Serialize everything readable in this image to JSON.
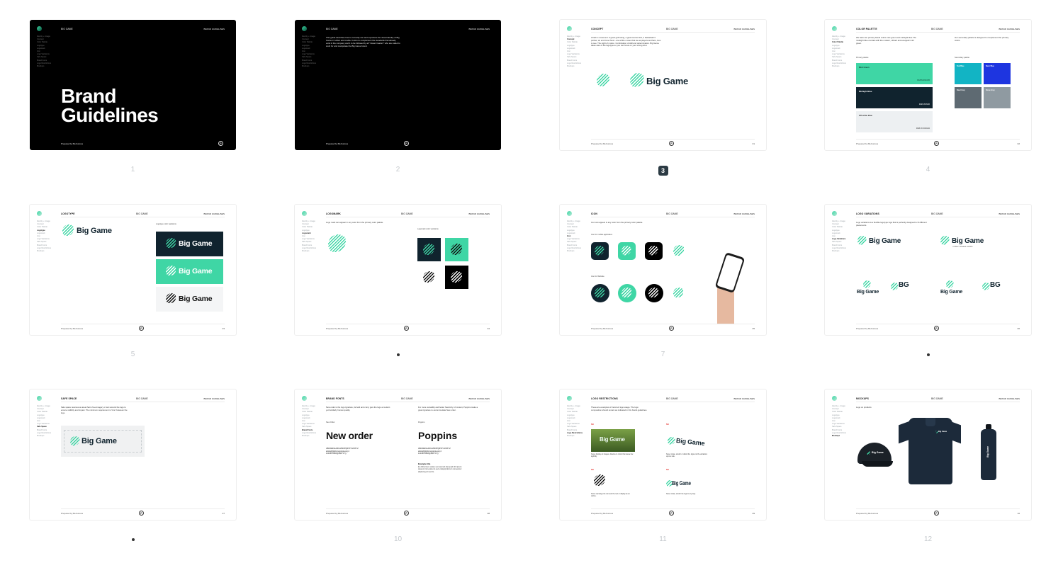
{
  "brand": {
    "name": "Big Game",
    "short": "BG",
    "header_brand": "BIG GAME",
    "header_guides": "BRAND GUIDELINES",
    "prepared_by": "Prepared by BeCurious",
    "footer_mark": "P"
  },
  "colors": {
    "green": "#3fd6a5",
    "navy": "#10232e",
    "black": "#000000"
  },
  "nav": [
    "Identity + Usage",
    "Concept",
    "Color Palette",
    "Logotype",
    "Logomark",
    "Icon",
    "Logo Variations",
    "Safe Space",
    "Brand Fonts",
    "Logo Restrictions",
    "Mockups"
  ],
  "slides": [
    {
      "num": "1",
      "title": "Brand Guidelines",
      "title_l1": "Brand",
      "title_l2": "Guidelines"
    },
    {
      "num": "2",
      "intro": "This guide describes how to correctly use and reproduce the visual identity of Big Game in written and media. It aims to complement the standards that already exist in the company and it to be followed by all \"visual creators\" who are called to work for and manipulate the Big Game brand."
    },
    {
      "num": "3",
      "page": "01",
      "title": "CONCEPT",
      "text": "A ball in movement. A great golf swing, a great soccer kick, a basketball 3 pointer, an end zone throw - are all the moves that we as players and fans, love to see. The sight of motion. Combination of skill and determination. Big Game takes care of the logotype so you can focus on your strong shot."
    },
    {
      "num": "4",
      "page": "02",
      "title": "COLOR PALETTE",
      "text": "We have two primary brand colors mint green and midnight blue.The midnight blue contrast with the modern, vibrant and energetic mint green.",
      "text2": "Our secondary palette is designed to complement the primary colors.",
      "primary_label": "Primary palette",
      "secondary_label": "Secondary palette",
      "primary": [
        {
          "name": "Mint Green",
          "hex": "#3fd6a5",
          "codes": "RGB 63/214/165"
        },
        {
          "name": "Midnight Blue",
          "hex": "#10232e",
          "codes": "RGB 16/35/46"
        },
        {
          "name": "Off-white Blue",
          "hex": "#edf0f2",
          "codes": "RGB 237/240/242"
        }
      ],
      "secondary": [
        {
          "name": "Teal Blue",
          "hex": "#12b4c4"
        },
        {
          "name": "Neon Blue",
          "hex": "#1e35e0"
        },
        {
          "name": "Steel Grey",
          "hex": "#5e6a72"
        },
        {
          "name": "Stone Grey",
          "hex": "#8f9aa1"
        }
      ]
    },
    {
      "num": "5",
      "page": "03",
      "title": "LOGOTYPE",
      "sublabel": "Logotype color variations"
    },
    {
      "num": "6",
      "page": "04",
      "title": "LOGOMARK",
      "text": "Logo mark can appear in any color from the primary color palette.",
      "sublabel": "Logomark color variations"
    },
    {
      "num": "7",
      "page": "05",
      "title": "ICON",
      "text": "Icon can appear in any color from the primary color palette.",
      "label_a": "Icon for mobile application",
      "label_b": "Icon for Website"
    },
    {
      "num": "8",
      "page": "06",
      "title": "LOGO VARIATIONS",
      "text": "Logo variations is a flexible logotype logo that is perfectly designed to fit different placements.",
      "tagline": "CONNECT. ENGAGE. INSPIRE."
    },
    {
      "num": "9",
      "page": "07",
      "title": "SAFE SPACE",
      "text": "Safe space receives as area that is free imagery or text around the logo to ensure visibility and impact. The minimum requirement is 'Gnn' between the logo."
    },
    {
      "num": "10",
      "page": "08",
      "title": "BRAND FONTS",
      "text": "New order is the logo typeface, its bold and curvy give the logo a modern yet familiarly human quality.",
      "text2": "For more versatility and better hierarchy of content, Poppins make a great typeface to accommodate New order.",
      "font1": "New order",
      "font2": "Poppins",
      "font1_label": "New Order",
      "font2_label": "Poppins",
      "alphabet": "ABCDEFGHIJKLMNOPQRSTUVWXYZ",
      "alphabet_l": "abcdefghijklmnopqrstuvwxyz",
      "digits": "1234567890!@#$%^&*()",
      "example_title": "Example title",
      "example_text": "Ex officia lorem veliad, sed eiusmod dias quad nibh ipsum deserunt nisi eiusta nis sed et aliquip laborum consectetur adipiscing elit sed do."
    },
    {
      "num": "11",
      "page": "09",
      "title": "LOGO RESTRICTIONS",
      "text": "These are examples of incorrect logo usage. The logo composition should remain as indicated in this brand guidelines.",
      "no": "NO",
      "r1": "Never display on images, dissolve in colors that cause low legibility.",
      "r2": "Never rotate, stretch or distort the logo and the variations upon a side.",
      "r3": "Never rearrange the icon and the text or display as an outline.",
      "r4": "Never rotate, stretch the logo in any way."
    },
    {
      "num": "12",
      "page": "10",
      "title": "MOCKUPS",
      "text": "Logo on products"
    }
  ],
  "active_page": "3"
}
